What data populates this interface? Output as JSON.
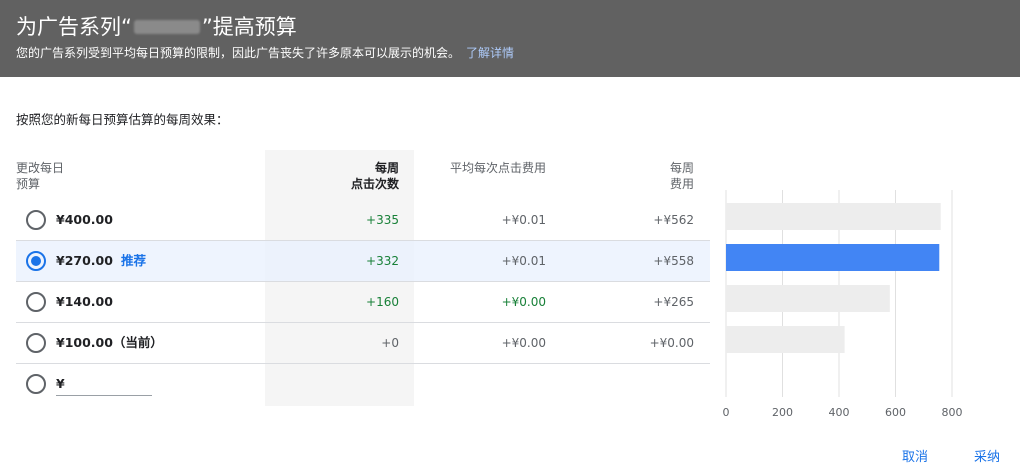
{
  "header": {
    "title_prefix": "为广告系列“",
    "title_suffix": "”提高预算",
    "subtitle": "您的广告系列受到平均每日预算的限制，因此广告丧失了许多原本可以展示的机会。",
    "learn_more": "了解详情"
  },
  "intro": "按照您的新每日预算估算的每周效果：",
  "columns": {
    "budget": [
      "更改每日",
      "预算"
    ],
    "clicks": [
      "每周",
      "点击次数"
    ],
    "cpc": "平均每次点击费用",
    "cost": [
      "每周",
      "费用"
    ]
  },
  "rows": [
    {
      "amount": "¥400.00",
      "tag": "",
      "clicks": "+335",
      "cpc": "+¥0.01",
      "cost": "+¥562",
      "selected": false,
      "clicks_green": true,
      "cpc_green": false
    },
    {
      "amount": "¥270.00",
      "tag": "推荐",
      "clicks": "+332",
      "cpc": "+¥0.01",
      "cost": "+¥558",
      "selected": true,
      "clicks_green": true,
      "cpc_green": false
    },
    {
      "amount": "¥140.00",
      "tag": "",
      "clicks": "+160",
      "cpc": "+¥0.00",
      "cost": "+¥265",
      "selected": false,
      "clicks_green": true,
      "cpc_green": true
    },
    {
      "amount": "¥100.00（当前）",
      "tag": "",
      "clicks": "+0",
      "cpc": "+¥0.00",
      "cost": "+¥0.00",
      "selected": false,
      "clicks_green": false,
      "cpc_green": false
    }
  ],
  "custom": {
    "currency": "¥",
    "value": ""
  },
  "chart_data": {
    "type": "bar",
    "orientation": "horizontal",
    "values": [
      760,
      755,
      580,
      420
    ],
    "xlim": [
      0,
      800
    ],
    "ticks": [
      "0",
      "200",
      "400",
      "600",
      "800"
    ],
    "highlight_index": 1,
    "colors": {
      "bar": "#ededed",
      "highlight": "#4285f4",
      "grid": "#e0e0e0"
    }
  },
  "actions": {
    "cancel": "取消",
    "adopt": "采纳"
  },
  "colors": {
    "header_bg": "#616161",
    "accent": "#1a73e8",
    "positive": "#188038"
  }
}
